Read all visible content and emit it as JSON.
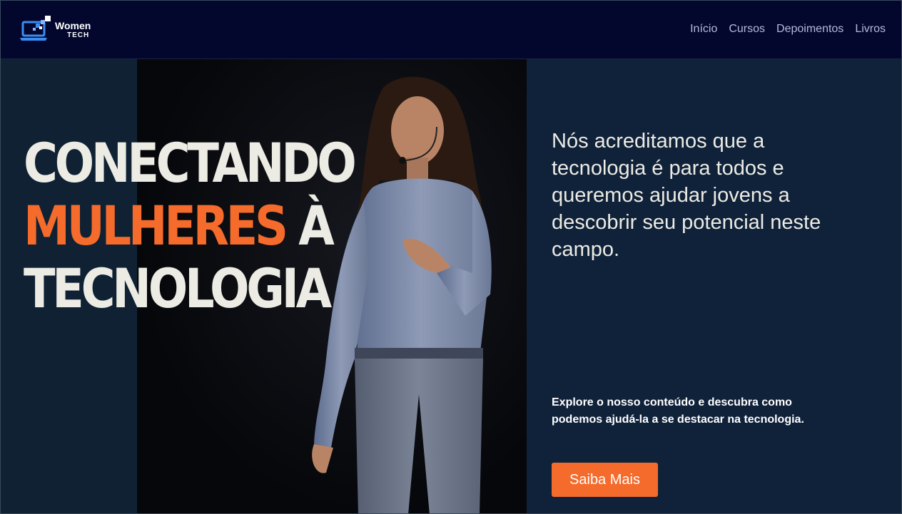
{
  "brand": {
    "name": "Women",
    "sub": "TECH",
    "icon": "laptop-pixels-icon"
  },
  "nav": {
    "items": [
      {
        "label": "Início"
      },
      {
        "label": "Cursos"
      },
      {
        "label": "Depoimentos"
      },
      {
        "label": "Livros"
      }
    ]
  },
  "hero": {
    "headline_line1": "CONECTANDO",
    "headline_accent": "MULHERES",
    "headline_line2_rest": " À",
    "headline_line3": "TECNOLOGIA",
    "lead": "Nós acreditamos que a tecnologia é para todos e queremos ajudar jovens a descobrir seu potencial neste campo.",
    "sub": "Explore o nosso conteúdo e descubra como podemos ajudá-la a se destacar na tecnologia.",
    "cta": "Saiba Mais",
    "photo": "woman-speaker-photo"
  },
  "colors": {
    "header_bg": "#03072e",
    "page_bg": "#0f2133",
    "accent": "#f46b2c",
    "headline_text": "#ecebe4",
    "nav_text": "#b7b9d6"
  }
}
